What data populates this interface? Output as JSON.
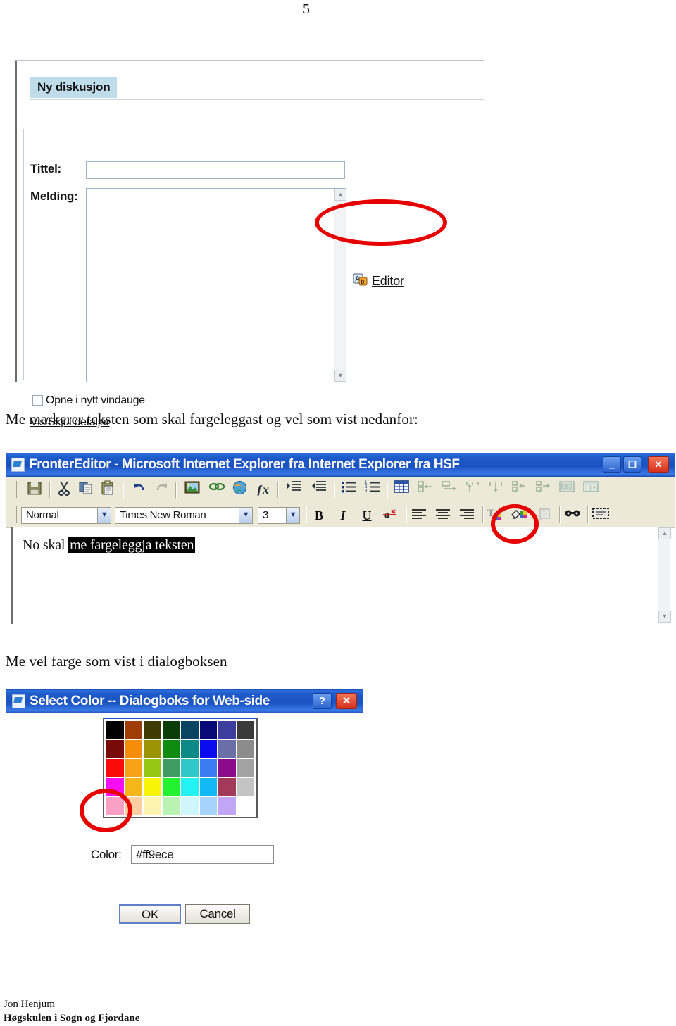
{
  "document": {
    "page_number": "5",
    "prose": [
      "Me markerer teksten som skal fargeleggast og vel som vist nedanfor:",
      "Me vel farge som vist i dialogboksen"
    ],
    "footer": {
      "author": "Jon Henjum",
      "institution": "Høgskulen i Sogn og Fjordane"
    }
  },
  "discussion_form": {
    "tab_label": "Ny diskusjon",
    "title_label": "Tittel:",
    "title_value": "",
    "message_label": "Melding:",
    "message_value": "",
    "checkbox_label": "Opne i nytt vindauge",
    "details_link": "Vis/Skjul detaljar",
    "editor_link": "Editor",
    "scroll_up": "▲",
    "scroll_down": "▼"
  },
  "editor_window": {
    "title": "FronterEditor - Microsoft Internet Explorer fra Internet Explorer fra HSF",
    "window_buttons": {
      "minimize": "_",
      "maximize": "❑",
      "close": "✕"
    },
    "toolbar_row1": [
      {
        "name": "save-icon",
        "label": "save"
      },
      {
        "name": "cut-icon",
        "label": "cut"
      },
      {
        "name": "copy-icon",
        "label": "copy"
      },
      {
        "name": "paste-icon",
        "label": "paste"
      },
      {
        "name": "undo-icon",
        "label": "undo"
      },
      {
        "name": "redo-icon",
        "label": "redo"
      },
      {
        "name": "insert-image-icon",
        "label": "insert image"
      },
      {
        "name": "insert-link-icon",
        "label": "insert link"
      },
      {
        "name": "globe-icon",
        "label": "web link"
      },
      {
        "name": "formula-icon",
        "label": "fx"
      },
      {
        "name": "indent-increase-icon",
        "label": "increase indent"
      },
      {
        "name": "indent-decrease-icon",
        "label": "decrease indent"
      },
      {
        "name": "bullet-list-icon",
        "label": "bullet list"
      },
      {
        "name": "numbered-list-icon",
        "label": "numbered list"
      },
      {
        "name": "insert-table-icon",
        "label": "insert table"
      },
      {
        "name": "insert-column-left-icon",
        "label": "insert column left"
      },
      {
        "name": "insert-column-right-icon",
        "label": "insert column right"
      },
      {
        "name": "insert-row-above-icon",
        "label": "insert row above"
      },
      {
        "name": "insert-row-below-icon",
        "label": "insert row below"
      },
      {
        "name": "delete-column-icon",
        "label": "delete column"
      },
      {
        "name": "delete-row-icon",
        "label": "delete row"
      },
      {
        "name": "merge-cells-icon",
        "label": "merge cells"
      },
      {
        "name": "split-cells-icon",
        "label": "split cells"
      }
    ],
    "style_select": "Normal",
    "font_select": "Times New Roman",
    "size_select": "3",
    "format_buttons": [
      {
        "name": "bold-button",
        "label": "B"
      },
      {
        "name": "italic-button",
        "label": "I"
      },
      {
        "name": "underline-button",
        "label": "U"
      },
      {
        "name": "remove-format-button",
        "label": "clear formatting"
      },
      {
        "name": "align-left-button",
        "label": "align left"
      },
      {
        "name": "align-center-button",
        "label": "align center"
      },
      {
        "name": "align-right-button",
        "label": "align right"
      },
      {
        "name": "text-color-button",
        "label": "text color"
      },
      {
        "name": "background-color-button",
        "label": "background color"
      },
      {
        "name": "paste-special-button",
        "label": "paste special"
      },
      {
        "name": "find-button",
        "label": "find"
      },
      {
        "name": "select-all-button",
        "label": "select all"
      }
    ],
    "content_plain": "No skal ",
    "content_selected": "me fargeleggja teksten"
  },
  "color_dialog": {
    "title": "Select Color -- Dialogboks for Web-side",
    "help_button": "?",
    "close_button": "✕",
    "color_label": "Color:",
    "color_value": "#ff9ece",
    "ok_button": "OK",
    "cancel_button": "Cancel",
    "palette": {
      "columns": 8,
      "rows": 5,
      "swatches": [
        [
          "#000000",
          "#a03c06",
          "#3d3a04",
          "#0b3d09",
          "#0b4463",
          "#080879",
          "#3d3d9e",
          "#3a3a3a"
        ],
        [
          "#7a0a0a",
          "#f78c08",
          "#9c9405",
          "#0f8c0f",
          "#0d8a87",
          "#0b0bf0",
          "#6a6fa8",
          "#8c8c8c"
        ],
        [
          "#fa0a0a",
          "#f7a318",
          "#96c714",
          "#3f9c63",
          "#2fc7c7",
          "#3a7cf2",
          "#8c0a8c",
          "#a3a3a3"
        ],
        [
          "#f70ef7",
          "#f5b718",
          "#f7f40a",
          "#22f22f",
          "#22f2f2",
          "#12b9f5",
          "#a33a5c",
          "#c4c4c4"
        ],
        [
          "#f9a0c4",
          "#fbcfa2",
          "#fbf5b0",
          "#b9f2b2",
          "#cff7fb",
          "#a6d3fa",
          "#c1a6f7",
          "#ffffff"
        ]
      ],
      "highlighted_swatch": {
        "row": 4,
        "col": 0,
        "hex": "#f9a0c4"
      }
    }
  },
  "annotations": [
    {
      "name": "editor-link-highlight",
      "shape": "ellipse"
    },
    {
      "name": "background-color-highlight",
      "shape": "ellipse"
    },
    {
      "name": "pink-swatch-highlight",
      "shape": "ellipse"
    }
  ]
}
